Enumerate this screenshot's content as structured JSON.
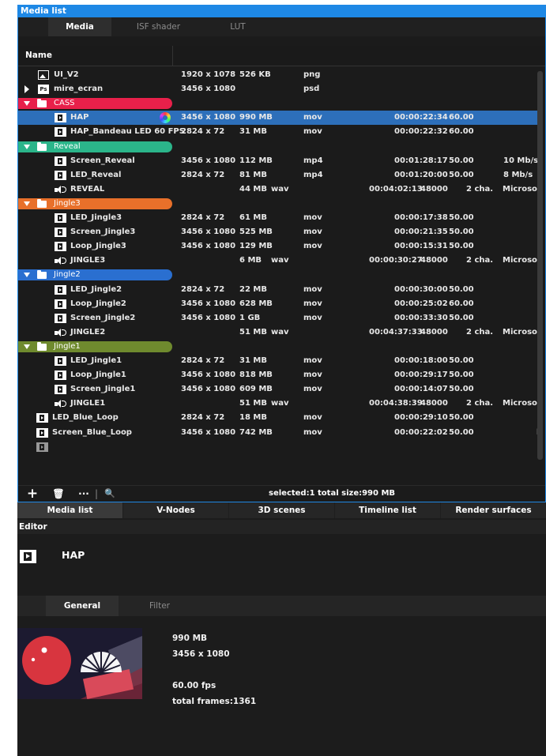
{
  "window": {
    "title": "Media list"
  },
  "tabs": [
    "Media",
    "ISF shader",
    "LUT"
  ],
  "columns": {
    "name": "Name"
  },
  "rows": [
    {
      "kind": "file",
      "icon": "image-icon",
      "name": "UI_V2",
      "res": "1920 x 1078",
      "size": "526 KB",
      "type": "png"
    },
    {
      "kind": "file",
      "icon": "photoshop-icon",
      "icon_text": "Ps",
      "expand": true,
      "name": "mire_ecran",
      "res": "3456 x 1080",
      "size": "",
      "type": "psd"
    },
    {
      "kind": "folder",
      "name": "CASS",
      "color": "#e8204a"
    },
    {
      "kind": "file",
      "icon": "film-icon",
      "selected": true,
      "wheel": true,
      "name": "HAP",
      "res": "3456 x 1080",
      "size": "990 MB",
      "type": "mov",
      "dur": "00:00:22:34",
      "fps": "60.00"
    },
    {
      "kind": "file",
      "icon": "film-icon",
      "name": "HAP_Bandeau LED 60 FPS",
      "res": "2824 x 72",
      "size": "31 MB",
      "type": "mov",
      "dur": "00:00:22:32",
      "fps": "60.00"
    },
    {
      "kind": "folder",
      "name": "Reveal",
      "color": "#2bb58a"
    },
    {
      "kind": "file",
      "icon": "film-icon",
      "name": "Screen_Reveal",
      "res": "3456 x 1080",
      "size": "112 MB",
      "type": "mp4",
      "dur": "00:01:28:17",
      "fps": "50.00",
      "extra": "10 Mb/s"
    },
    {
      "kind": "file",
      "icon": "film-icon",
      "name": "LED_Reveal",
      "res": "2824 x 72",
      "size": "81 MB",
      "type": "mp4",
      "dur": "00:01:20:00",
      "fps": "50.00",
      "extra": "8 Mb/s"
    },
    {
      "kind": "audio",
      "icon": "speaker-icon",
      "name": "REVEAL",
      "size": "44 MB",
      "type": "wav",
      "dur": "00:04:02:13",
      "fps": "48000",
      "ch": "2 cha.",
      "extra": "Microsof"
    },
    {
      "kind": "folder",
      "name": "Jingle3",
      "color": "#e8702a"
    },
    {
      "kind": "file",
      "icon": "film-icon",
      "name": "LED_Jingle3",
      "res": "2824 x 72",
      "size": "61 MB",
      "type": "mov",
      "dur": "00:00:17:38",
      "fps": "50.00"
    },
    {
      "kind": "file",
      "icon": "film-icon",
      "name": "Screen_Jingle3",
      "res": "3456 x 1080",
      "size": "525 MB",
      "type": "mov",
      "dur": "00:00:21:35",
      "fps": "50.00"
    },
    {
      "kind": "file",
      "icon": "film-icon",
      "name": "Loop_Jingle3",
      "res": "3456 x 1080",
      "size": "129 MB",
      "type": "mov",
      "dur": "00:00:15:31",
      "fps": "50.00"
    },
    {
      "kind": "audio",
      "icon": "speaker-icon",
      "name": "JINGLE3",
      "size": "6 MB",
      "type": "wav",
      "dur": "00:00:30:27",
      "fps": "48000",
      "ch": "2 cha.",
      "extra": "Microsof"
    },
    {
      "kind": "folder",
      "name": "Jingle2",
      "color": "#2a6fd0"
    },
    {
      "kind": "file",
      "icon": "film-icon",
      "name": "LED_Jingle2",
      "res": "2824 x 72",
      "size": "22 MB",
      "type": "mov",
      "dur": "00:00:30:00",
      "fps": "50.00"
    },
    {
      "kind": "file",
      "icon": "film-icon",
      "name": "Loop_Jingle2",
      "res": "3456 x 1080",
      "size": "628 MB",
      "type": "mov",
      "dur": "00:00:25:02",
      "fps": "60.00"
    },
    {
      "kind": "file",
      "icon": "film-icon",
      "name": "Screen_Jingle2",
      "res": "3456 x 1080",
      "size": "1 GB",
      "type": "mov",
      "dur": "00:00:33:30",
      "fps": "50.00"
    },
    {
      "kind": "audio",
      "icon": "speaker-icon",
      "name": "JINGLE2",
      "size": "51 MB",
      "type": "wav",
      "dur": "00:04:37:33",
      "fps": "48000",
      "ch": "2 cha.",
      "extra": "Microsof"
    },
    {
      "kind": "folder",
      "name": "Jingle1",
      "color": "#6f8a2e"
    },
    {
      "kind": "file",
      "icon": "film-icon",
      "name": "LED_Jingle1",
      "res": "2824 x 72",
      "size": "31 MB",
      "type": "mov",
      "dur": "00:00:18:00",
      "fps": "50.00"
    },
    {
      "kind": "file",
      "icon": "film-icon",
      "name": "Loop_Jingle1",
      "res": "3456 x 1080",
      "size": "818 MB",
      "type": "mov",
      "dur": "00:00:29:17",
      "fps": "50.00"
    },
    {
      "kind": "file",
      "icon": "film-icon",
      "name": "Screen_Jingle1",
      "res": "3456 x 1080",
      "size": "609 MB",
      "type": "mov",
      "dur": "00:00:14:07",
      "fps": "50.00"
    },
    {
      "kind": "audio",
      "icon": "speaker-icon",
      "name": "JINGLE1",
      "size": "51 MB",
      "type": "wav",
      "dur": "00:04:38:39",
      "fps": "48000",
      "ch": "2 cha.",
      "extra": "Microsof"
    },
    {
      "kind": "file",
      "icon": "film-icon",
      "top": true,
      "name": "LED_Blue_Loop",
      "res": "2824 x 72",
      "size": "18 MB",
      "type": "mov",
      "dur": "00:00:29:10",
      "fps": "50.00"
    },
    {
      "kind": "file",
      "icon": "film-icon",
      "top": true,
      "name": "Screen_Blue_Loop",
      "res": "3456 x 1080",
      "size": "742 MB",
      "type": "mov",
      "dur": "00:00:22:02",
      "fps": "50.00",
      "extra": "h"
    }
  ],
  "toolbar": {
    "add": "+",
    "delete": "🗑",
    "more": "···",
    "divider": "|",
    "search": "🔍"
  },
  "status": "selected:1 total size:990 MB",
  "bottom_tabs": [
    "Media list",
    "V-Nodes",
    "3D scenes",
    "Timeline list",
    "Render surfaces"
  ],
  "editor": {
    "title": "Editor",
    "item_name": "HAP",
    "tabs": [
      "General",
      "Filter"
    ],
    "info": {
      "size": "990 MB",
      "resolution": "3456 x 1080",
      "fps": "60.00 fps",
      "frames": "total frames:1361"
    }
  },
  "colors": {
    "accent": "#1e88e5",
    "selection": "#2d6fba"
  }
}
